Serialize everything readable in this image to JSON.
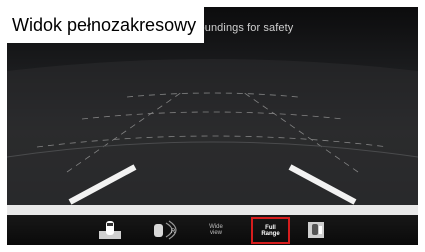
{
  "caption": {
    "text": "Widok pełnozakresowy"
  },
  "camera": {
    "hint_text": "rroundings for safety"
  },
  "toolbar": {
    "buttons": [
      {
        "icon": "top-view-car-icon"
      },
      {
        "icon": "rear-sensor-r-icon",
        "badge": "R"
      },
      {
        "line1": "Wide",
        "line2": "view"
      },
      {
        "line1": "Full",
        "line2": "Range",
        "selected": true
      },
      {
        "icon": "side-view-icon"
      }
    ]
  },
  "colors": {
    "selected_outline": "#d61d1d",
    "guide_line": "#f2f2f2"
  }
}
